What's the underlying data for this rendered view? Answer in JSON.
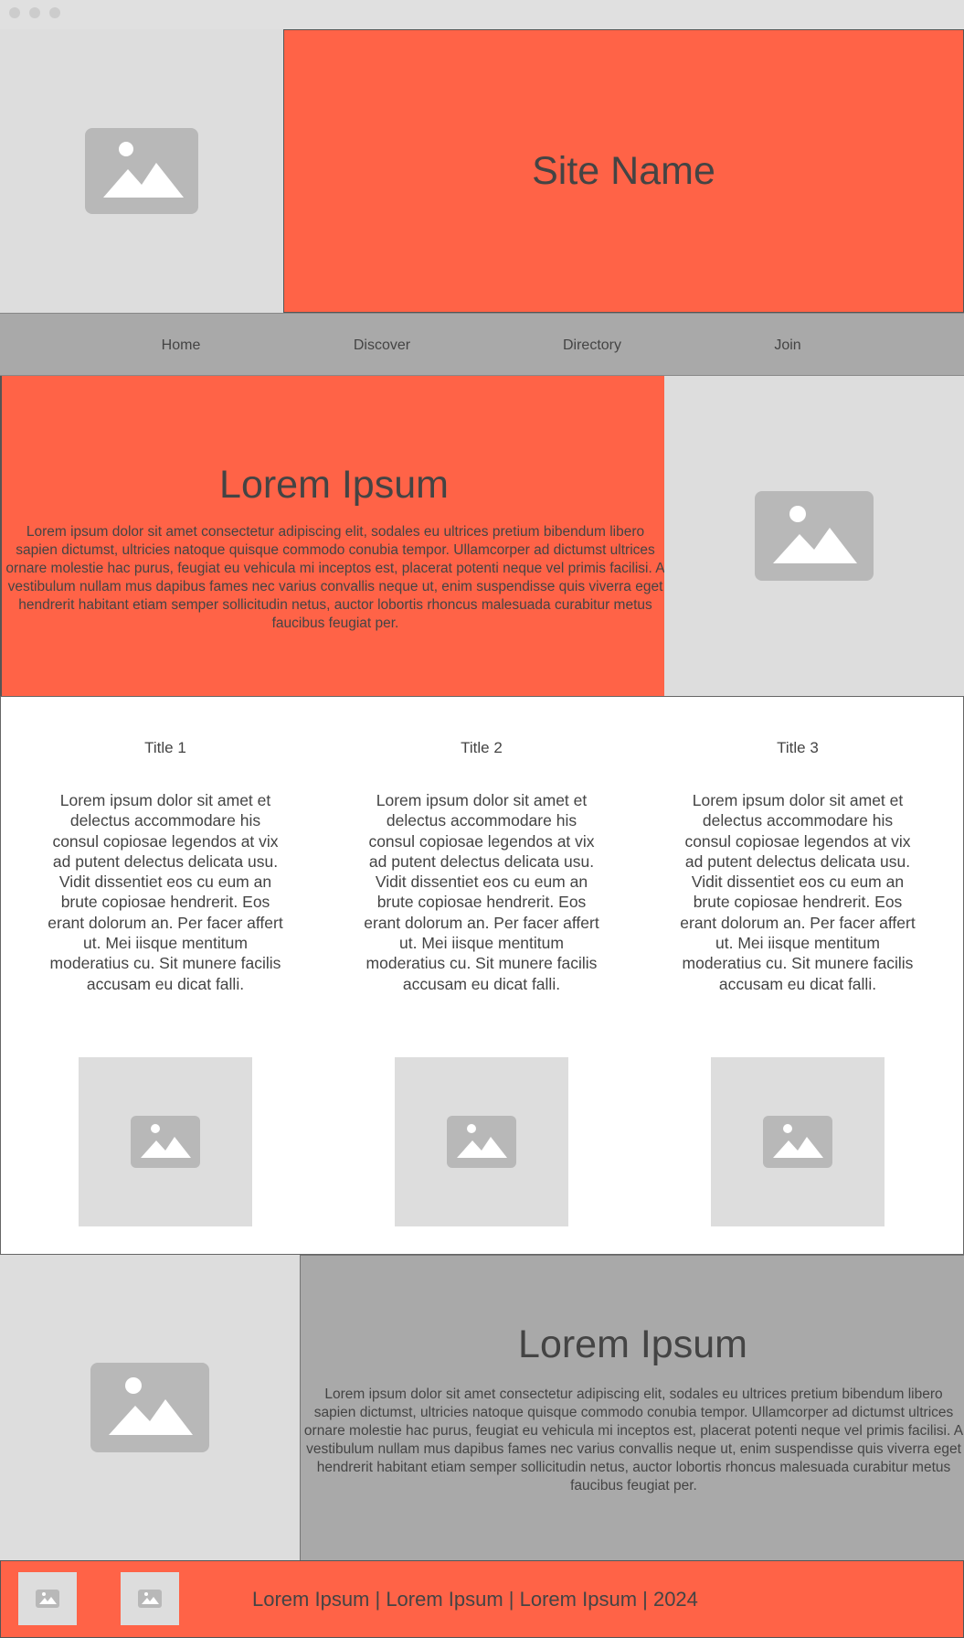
{
  "header": {
    "site_name": "Site Name",
    "logo_icon": "image-placeholder-icon"
  },
  "nav": {
    "items": [
      {
        "label": "Home"
      },
      {
        "label": "Discover"
      },
      {
        "label": "Directory"
      },
      {
        "label": "Join"
      }
    ]
  },
  "hero": {
    "heading": "Lorem Ipsum",
    "body": "Lorem ipsum dolor sit amet consectetur adipiscing elit, sodales eu ultrices pretium bibendum libero sapien dictumst, ultricies natoque quisque commodo conubia tempor. Ullamcorper ad dictumst ultrices ornare molestie hac purus, feugiat eu vehicula mi inceptos est, placerat potenti neque vel primis facilisi. A vestibulum nullam mus dapibus fames nec varius convallis neque ut, enim suspendisse quis viverra eget hendrerit habitant etiam semper sollicitudin netus, auctor lobortis rhoncus malesuada curabitur metus faucibus feugiat per."
  },
  "features": [
    {
      "title": "Title 1",
      "body": "Lorem ipsum dolor sit amet et delectus accommodare his consul copiosae legendos at vix ad putent delectus delicata usu. Vidit dissentiet eos cu eum an brute copiosae hendrerit. Eos erant dolorum an. Per facer affert ut. Mei iisque mentitum moderatius cu. Sit munere facilis accusam eu dicat falli."
    },
    {
      "title": "Title 2",
      "body": "Lorem ipsum dolor sit amet et delectus accommodare his consul copiosae legendos at vix ad putent delectus delicata usu. Vidit dissentiet eos cu eum an brute copiosae hendrerit. Eos erant dolorum an. Per facer affert ut. Mei iisque mentitum moderatius cu. Sit munere facilis accusam eu dicat falli."
    },
    {
      "title": "Title 3",
      "body": "Lorem ipsum dolor sit amet et delectus accommodare his consul copiosae legendos at vix ad putent delectus delicata usu. Vidit dissentiet eos cu eum an brute copiosae hendrerit. Eos erant dolorum an. Per facer affert ut. Mei iisque mentitum moderatius cu. Sit munere facilis accusam eu dicat falli."
    }
  ],
  "band": {
    "heading": "Lorem Ipsum",
    "body": "Lorem ipsum dolor sit amet consectetur adipiscing elit, sodales eu ultrices pretium bibendum libero sapien dictumst, ultricies natoque quisque commodo conubia tempor. Ullamcorper ad dictumst ultrices ornare molestie hac purus, feugiat eu vehicula mi inceptos est, placerat potenti neque vel primis facilisi. A vestibulum nullam mus dapibus fames nec varius convallis neque ut, enim suspendisse quis viverra eget hendrerit habitant etiam semper sollicitudin netus, auctor lobortis rhoncus malesuada curabitur metus faucibus feugiat per."
  },
  "footer": {
    "text": "Lorem Ipsum | Lorem Ipsum | Lorem Ipsum | 2024"
  },
  "colors": {
    "accent": "#ff6347",
    "nav_bg": "#a9a9a9",
    "placeholder_bg": "#dddddd",
    "placeholder_icon": "#b8b8b8",
    "text": "#444444"
  }
}
